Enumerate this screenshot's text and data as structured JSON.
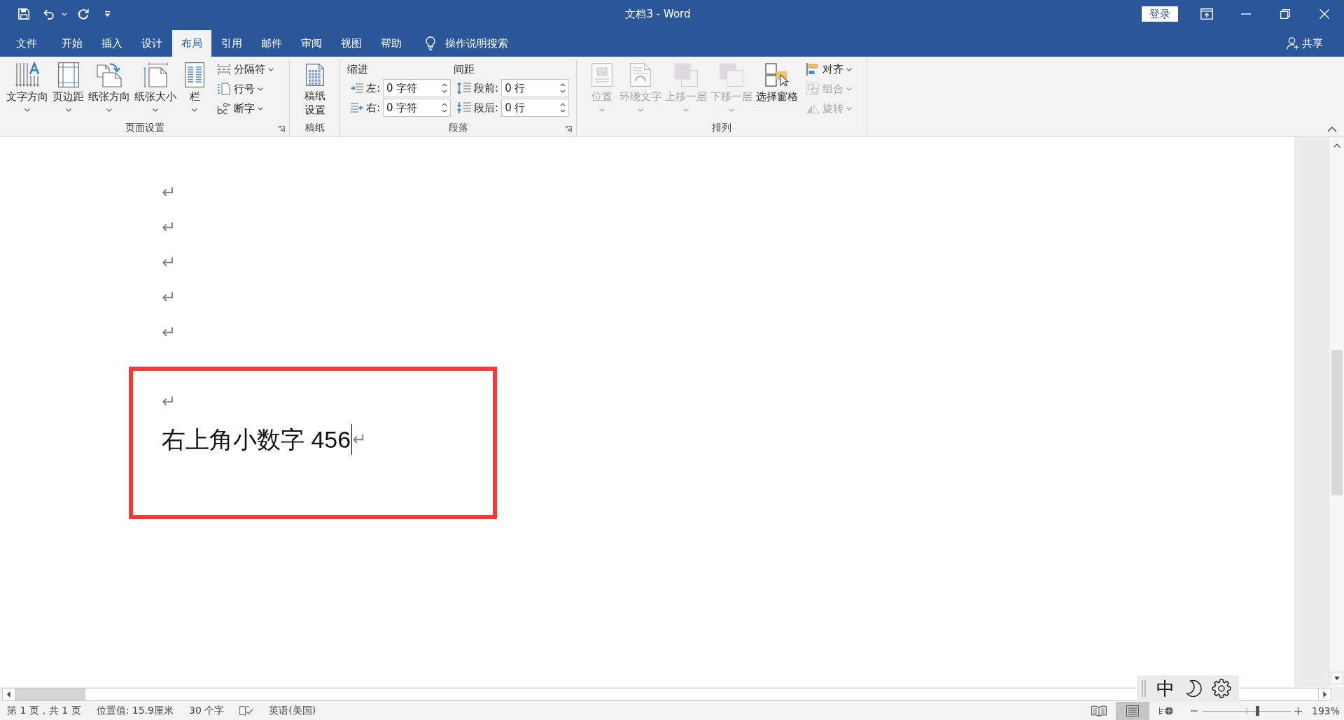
{
  "window": {
    "title": "文档3 - Word",
    "sign_in": "登录"
  },
  "tabs": [
    {
      "label": "文件",
      "selected": false
    },
    {
      "label": "开始",
      "selected": false
    },
    {
      "label": "插入",
      "selected": false
    },
    {
      "label": "设计",
      "selected": false
    },
    {
      "label": "布局",
      "selected": true
    },
    {
      "label": "引用",
      "selected": false
    },
    {
      "label": "邮件",
      "selected": false
    },
    {
      "label": "审阅",
      "selected": false
    },
    {
      "label": "视图",
      "selected": false
    },
    {
      "label": "帮助",
      "selected": false
    }
  ],
  "tell_me": {
    "label": "操作说明搜索"
  },
  "share": {
    "label": "共享"
  },
  "ribbon": {
    "groups": [
      {
        "label": "页面设置",
        "kind": "buttons",
        "launcher": true,
        "items": [
          {
            "kind": "large",
            "label": "文字方向",
            "dropdown": true,
            "disabled": false
          },
          {
            "kind": "large",
            "label": "页边距",
            "dropdown": true,
            "disabled": false
          },
          {
            "kind": "large",
            "label": "纸张方向",
            "dropdown": true,
            "disabled": false
          },
          {
            "kind": "large",
            "label": "纸张大小",
            "dropdown": true,
            "disabled": false
          },
          {
            "kind": "large",
            "label": "栏",
            "dropdown": true,
            "disabled": false
          },
          {
            "kind": "small",
            "label": "分隔符",
            "dropdown": true,
            "disabled": false
          },
          {
            "kind": "small",
            "label": "行号",
            "dropdown": true,
            "disabled": false
          },
          {
            "kind": "small",
            "label": "断字",
            "dropdown": true,
            "disabled": false
          }
        ]
      },
      {
        "label": "稿纸",
        "kind": "buttons",
        "launcher": false,
        "items": [
          {
            "kind": "large",
            "lines": [
              "稿纸",
              "设置"
            ],
            "dropdown": false,
            "disabled": false
          }
        ]
      },
      {
        "label": "段落",
        "kind": "fields",
        "launcher": true,
        "sections": [
          {
            "heading": "缩进",
            "fields": [
              {
                "label": "左:",
                "value": "0 字符"
              },
              {
                "label": "右:",
                "value": "0 字符"
              }
            ]
          },
          {
            "heading": "间距",
            "fields": [
              {
                "label": "段前:",
                "value": "0 行"
              },
              {
                "label": "段后:",
                "value": "0 行"
              }
            ]
          }
        ]
      },
      {
        "label": "排列",
        "kind": "buttons",
        "launcher": false,
        "items": [
          {
            "kind": "large",
            "label": "位置",
            "dropdown": true,
            "disabled": true
          },
          {
            "kind": "large",
            "label": "环绕文字",
            "dropdown": true,
            "disabled": true
          },
          {
            "kind": "large",
            "label": "上移一层",
            "dropdown": true,
            "disabled": true
          },
          {
            "kind": "large",
            "label": "下移一层",
            "dropdown": true,
            "disabled": true
          },
          {
            "kind": "large",
            "label": "选择窗格",
            "dropdown": false,
            "disabled": false
          },
          {
            "kind": "small",
            "label": "对齐",
            "dropdown": true,
            "disabled": false
          },
          {
            "kind": "small",
            "label": "组合",
            "dropdown": true,
            "disabled": true
          },
          {
            "kind": "small",
            "label": "旋转",
            "dropdown": true,
            "disabled": true
          }
        ]
      }
    ]
  },
  "document": {
    "paragraphs": [
      {
        "mark": "↵",
        "caret": false,
        "highlighted": false
      },
      {
        "mark": "↵",
        "caret": false,
        "highlighted": false
      },
      {
        "mark": "↵",
        "caret": false,
        "highlighted": false
      },
      {
        "mark": "↵",
        "caret": false,
        "highlighted": false
      },
      {
        "mark": "↵",
        "caret": false,
        "highlighted": false
      },
      {
        "mark": "↵",
        "caret": false,
        "highlighted": true
      },
      {
        "text": "右上角小数字 456",
        "mark": "↵",
        "caret": true,
        "highlighted": true
      }
    ]
  },
  "ime_toolbar": {
    "mode": "中"
  },
  "status_bar": {
    "items": [
      "第 1 页，共 1 页",
      "位置值: 15.9厘米",
      "30 个字"
    ],
    "language": "英语(美国)",
    "views": [
      {
        "selected": false
      },
      {
        "selected": true
      },
      {
        "selected": false
      }
    ],
    "zoom": {
      "level": 0.62,
      "reading": "193%"
    }
  }
}
